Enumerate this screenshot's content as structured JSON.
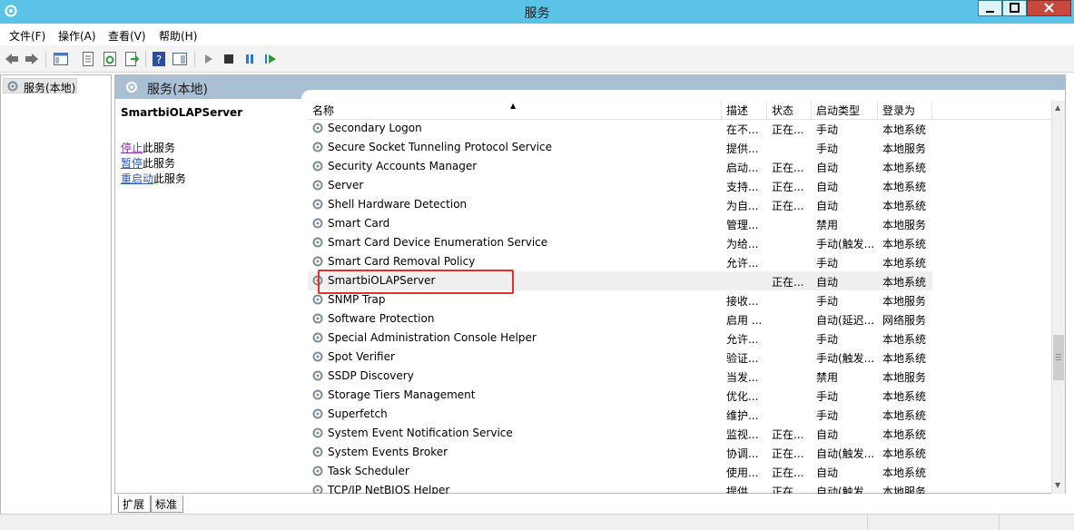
{
  "window": {
    "title": "服务"
  },
  "menu": [
    "文件(F)",
    "操作(A)",
    "查看(V)",
    "帮助(H)"
  ],
  "toolbar": {
    "icons": [
      "back-arrow-icon",
      "forward-arrow-icon",
      "show-console-tree-icon",
      "properties-icon",
      "refresh-icon",
      "export-list-icon",
      "help-icon",
      "show-action-pane-icon",
      "start-service-icon",
      "stop-service-icon",
      "pause-service-icon",
      "restart-service-icon"
    ]
  },
  "tree": {
    "root": "服务(本地)"
  },
  "pane": {
    "title": "服务(本地)",
    "selected_service": "SmartbiOLAPServer",
    "actions": [
      {
        "link": "停止",
        "text": "此服务"
      },
      {
        "link": "暂停",
        "text": "此服务"
      },
      {
        "link": "重启动",
        "text": "此服务"
      }
    ]
  },
  "grid": {
    "columns": [
      "名称",
      "描述",
      "状态",
      "启动类型",
      "登录为"
    ],
    "sort_column": "名称",
    "rows": [
      {
        "name": "Secondary Logon",
        "desc": "在不...",
        "status": "正在...",
        "startup": "手动",
        "logon": "本地系统"
      },
      {
        "name": "Secure Socket Tunneling Protocol Service",
        "desc": "提供...",
        "status": "",
        "startup": "手动",
        "logon": "本地服务"
      },
      {
        "name": "Security Accounts Manager",
        "desc": "启动...",
        "status": "正在...",
        "startup": "自动",
        "logon": "本地系统"
      },
      {
        "name": "Server",
        "desc": "支持...",
        "status": "正在...",
        "startup": "自动",
        "logon": "本地系统"
      },
      {
        "name": "Shell Hardware Detection",
        "desc": "为自...",
        "status": "正在...",
        "startup": "自动",
        "logon": "本地系统"
      },
      {
        "name": "Smart Card",
        "desc": "管理...",
        "status": "",
        "startup": "禁用",
        "logon": "本地服务"
      },
      {
        "name": "Smart Card Device Enumeration Service",
        "desc": "为给...",
        "status": "",
        "startup": "手动(触发...",
        "logon": "本地系统"
      },
      {
        "name": "Smart Card Removal Policy",
        "desc": "允许...",
        "status": "",
        "startup": "手动",
        "logon": "本地系统"
      },
      {
        "name": "SmartbiOLAPServer",
        "desc": "",
        "status": "正在...",
        "startup": "自动",
        "logon": "本地系统",
        "selected": true
      },
      {
        "name": "SNMP Trap",
        "desc": "接收...",
        "status": "",
        "startup": "手动",
        "logon": "本地服务"
      },
      {
        "name": "Software Protection",
        "desc": "启用 ...",
        "status": "",
        "startup": "自动(延迟...",
        "logon": "网络服务"
      },
      {
        "name": "Special Administration Console Helper",
        "desc": "允许...",
        "status": "",
        "startup": "手动",
        "logon": "本地系统"
      },
      {
        "name": "Spot Verifier",
        "desc": "验证...",
        "status": "",
        "startup": "手动(触发...",
        "logon": "本地系统"
      },
      {
        "name": "SSDP Discovery",
        "desc": "当发...",
        "status": "",
        "startup": "禁用",
        "logon": "本地服务"
      },
      {
        "name": "Storage Tiers Management",
        "desc": "优化...",
        "status": "",
        "startup": "手动",
        "logon": "本地系统"
      },
      {
        "name": "Superfetch",
        "desc": "维护...",
        "status": "",
        "startup": "手动",
        "logon": "本地系统"
      },
      {
        "name": "System Event Notification Service",
        "desc": "监视...",
        "status": "正在...",
        "startup": "自动",
        "logon": "本地系统"
      },
      {
        "name": "System Events Broker",
        "desc": "协调...",
        "status": "正在...",
        "startup": "自动(触发...",
        "logon": "本地系统"
      },
      {
        "name": "Task Scheduler",
        "desc": "使用...",
        "status": "正在...",
        "startup": "自动",
        "logon": "本地系统"
      },
      {
        "name": "TCP/IP NetBIOS Helper",
        "desc": "提供 ...",
        "status": "正在...",
        "startup": "自动(触发...",
        "logon": "本地服务"
      }
    ]
  },
  "tabs": [
    "扩展",
    "标准"
  ],
  "colors": {
    "titlebar": "#5cc3e8",
    "pane_header": "#a8bfd4",
    "link": "#2a56b8",
    "visited_link": "#8b2fa8",
    "highlight": "#e0322a"
  }
}
